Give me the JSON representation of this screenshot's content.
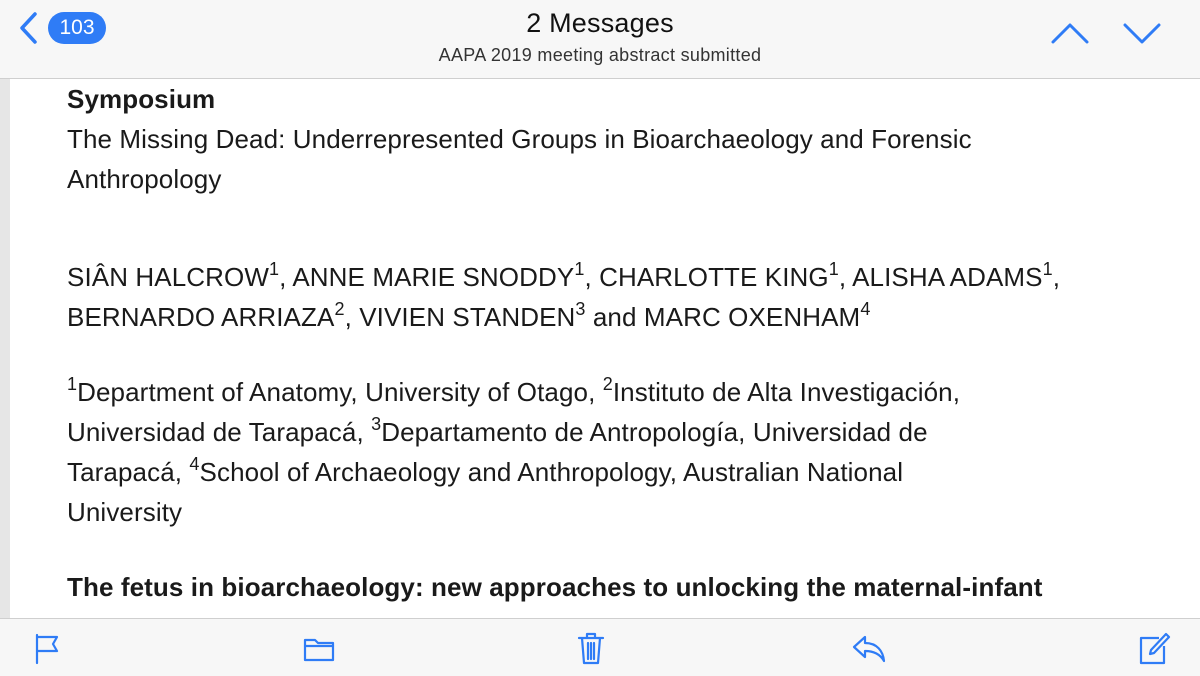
{
  "nav": {
    "back_count": "103",
    "title": "2 Messages",
    "subtitle": "AAPA 2019 meeting abstract submitted"
  },
  "message": {
    "symposium_label": "Symposium",
    "symposium_title_line1": "The Missing Dead: Underrepresented Groups in Bioarchaeology and Forensic",
    "symposium_title_line2": "Anthropology",
    "authors": [
      {
        "name": "SIÂN HALCROW",
        "aff": "1"
      },
      {
        "name": "ANNE MARIE SNODDY",
        "aff": "1"
      },
      {
        "name": "CHARLOTTE KING",
        "aff": "1"
      },
      {
        "name": "ALISHA ADAMS",
        "aff": "1"
      },
      {
        "name": "BERNARDO ARRIAZA",
        "aff": "2"
      },
      {
        "name": "VIVIEN STANDEN",
        "aff": "3"
      },
      {
        "name": "MARC OXENHAM",
        "aff": "4"
      }
    ],
    "and_word": "and",
    "affiliations": [
      {
        "num": "1",
        "text": "Department of Anatomy, University of Otago,"
      },
      {
        "num": "2",
        "text": "Instituto de Alta Investigación,"
      },
      {
        "text_cont": "Universidad de Tarapacá,"
      },
      {
        "num": "3",
        "text": "Departamento de Antropología, Universidad de"
      },
      {
        "text_cont": "Tarapacá,"
      },
      {
        "num": "4",
        "text": "School of Archaeology and Anthropology, Australian National"
      },
      {
        "text_cont": "University"
      }
    ],
    "paper_title": "The fetus in bioarchaeology: new approaches to unlocking the maternal-infant"
  },
  "toolbar": {
    "icons": [
      "flag-icon",
      "folder-icon",
      "trash-icon",
      "reply-icon",
      "compose-icon"
    ]
  },
  "colors": {
    "accent": "#2f7cf6",
    "bar_bg": "#f7f7f7"
  }
}
